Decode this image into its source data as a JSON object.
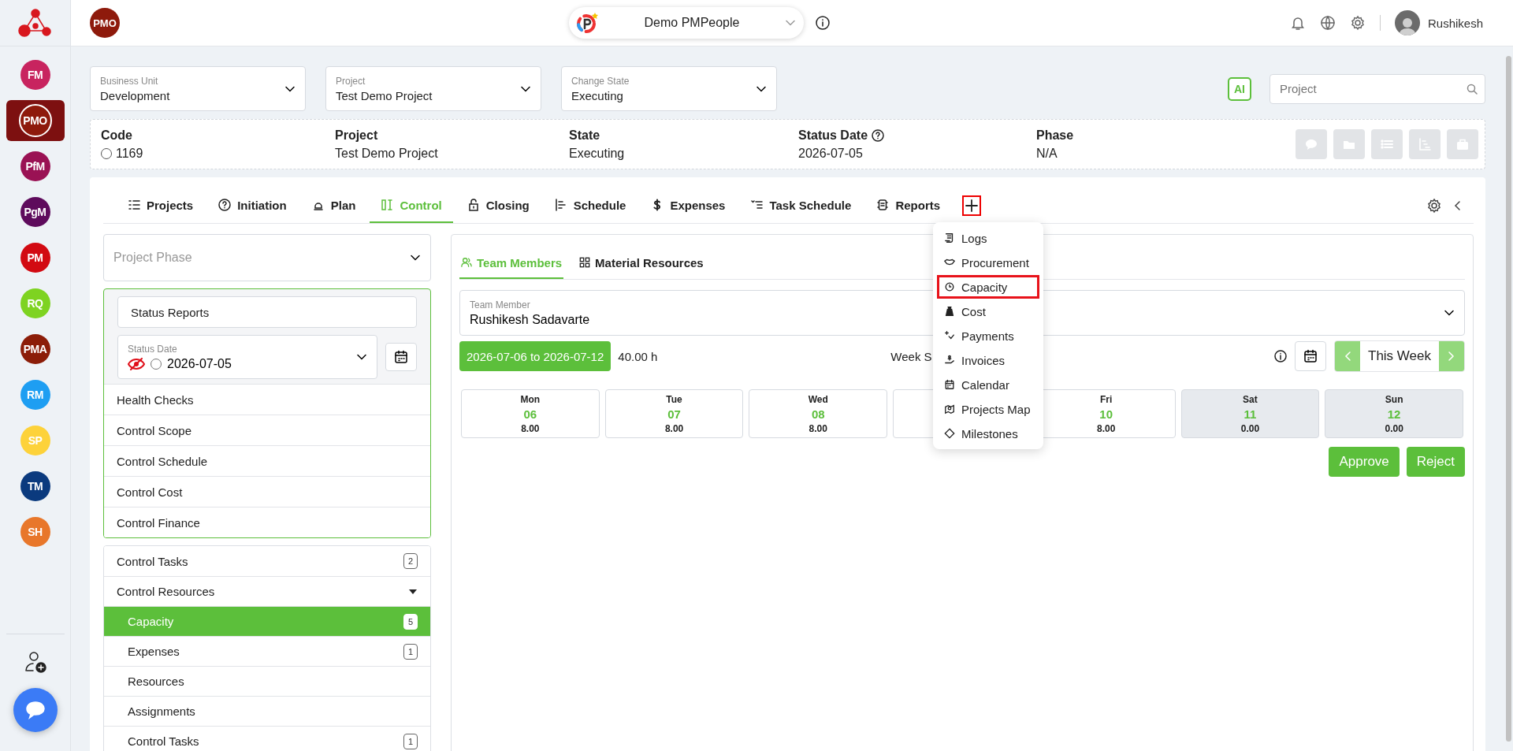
{
  "rail": {
    "items": [
      {
        "label": "FM",
        "color": "#c8245f",
        "selected": false
      },
      {
        "label": "PMO",
        "color": "#8e1a0c",
        "selected": true
      },
      {
        "label": "PfM",
        "color": "#9a1254",
        "selected": false
      },
      {
        "label": "PgM",
        "color": "#5e0b5c",
        "selected": false
      },
      {
        "label": "PM",
        "color": "#d20a12",
        "selected": false
      },
      {
        "label": "RQ",
        "color": "#7ed321",
        "selected": false
      },
      {
        "label": "PMA",
        "color": "#8c1d08",
        "selected": false
      },
      {
        "label": "RM",
        "color": "#1e9ef2",
        "selected": false
      },
      {
        "label": "SP",
        "color": "#fdd23a",
        "selected": false
      },
      {
        "label": "TM",
        "color": "#0b3a7e",
        "selected": false
      },
      {
        "label": "SH",
        "color": "#e8772b",
        "selected": false
      }
    ]
  },
  "topbar": {
    "module_badge": "PMO",
    "workspace": "Demo PMPeople",
    "user": "Rushikesh"
  },
  "filters": [
    {
      "label": "Business Unit",
      "value": "Development"
    },
    {
      "label": "Project",
      "value": "Test Demo Project"
    },
    {
      "label": "Change State",
      "value": "Executing"
    }
  ],
  "ai_button": "AI",
  "search": {
    "placeholder": "Project"
  },
  "summary": [
    {
      "label": "Code",
      "value": "1169",
      "kind": "radio",
      "checked": false
    },
    {
      "label": "Project",
      "value": "Test Demo Project",
      "kind": "plain"
    },
    {
      "label": "State",
      "value": "Executing",
      "kind": "plain"
    },
    {
      "label": "Status Date",
      "value": "2026-07-05",
      "kind": "help"
    },
    {
      "label": "Phase",
      "value": "N/A",
      "kind": "plain"
    }
  ],
  "tabs": [
    {
      "label": "Projects",
      "selected": false
    },
    {
      "label": "Initiation",
      "selected": false
    },
    {
      "label": "Plan",
      "selected": false
    },
    {
      "label": "Control",
      "selected": true
    },
    {
      "label": "Closing",
      "selected": false
    },
    {
      "label": "Schedule",
      "selected": false
    },
    {
      "label": "Expenses",
      "selected": false
    },
    {
      "label": "Task Schedule",
      "selected": false
    },
    {
      "label": "Reports",
      "selected": false
    }
  ],
  "more_menu": {
    "items": [
      {
        "label": "Logs",
        "highlighted": false
      },
      {
        "label": "Procurement",
        "highlighted": false
      },
      {
        "label": "Capacity",
        "highlighted": true
      },
      {
        "label": "Cost",
        "highlighted": false
      },
      {
        "label": "Payments",
        "highlighted": false
      },
      {
        "label": "Invoices",
        "highlighted": false
      },
      {
        "label": "Calendar",
        "highlighted": false
      },
      {
        "label": "Projects Map",
        "highlighted": false
      },
      {
        "label": "Milestones",
        "highlighted": false
      }
    ]
  },
  "left_panel": {
    "phase": {
      "placeholder": "Project Phase"
    },
    "status_report": {
      "value": "Status Reports"
    },
    "status_date": {
      "label": "Status Date",
      "value": "2026-07-05",
      "checked": false
    },
    "phase_items": [
      "Health Checks",
      "Control Scope",
      "Control Schedule",
      "Control Cost",
      "Control Finance"
    ],
    "nav": [
      {
        "kind": "item",
        "label": "Control Tasks",
        "count": "2",
        "selected": false
      },
      {
        "kind": "group",
        "label": "Control Resources",
        "expanded": true,
        "children": [
          {
            "label": "Capacity",
            "count": "5",
            "selected": true
          },
          {
            "label": "Expenses",
            "count": "1",
            "selected": false
          },
          {
            "label": "Resources",
            "selected": false
          },
          {
            "label": "Assignments",
            "selected": false
          },
          {
            "label": "Control Tasks",
            "count": "1",
            "selected": false
          }
        ]
      }
    ]
  },
  "resource_tabs": [
    {
      "label": "Team Members",
      "selected": true
    },
    {
      "label": "Material Resources",
      "selected": false
    }
  ],
  "team_member": {
    "label": "Team Member",
    "value": "Rushikesh Sadavarte"
  },
  "week": {
    "range": "2026-07-06 to 2026-07-12",
    "hours": "40.00 h",
    "summary_label": "Week S",
    "nav_label": "This Week"
  },
  "days": [
    {
      "name": "Mon",
      "date": "06",
      "hours": "8.00",
      "weekend": false
    },
    {
      "name": "Tue",
      "date": "07",
      "hours": "8.00",
      "weekend": false
    },
    {
      "name": "Wed",
      "date": "08",
      "hours": "8.00",
      "weekend": false
    },
    {
      "weekend": false
    },
    {
      "name": "Fri",
      "date": "10",
      "hours": "8.00",
      "weekend": false
    },
    {
      "name": "Sat",
      "date": "11",
      "hours": "0.00",
      "weekend": true
    },
    {
      "name": "Sun",
      "date": "12",
      "hours": "0.00",
      "weekend": true
    }
  ],
  "actions": [
    "Approve",
    "Reject"
  ]
}
